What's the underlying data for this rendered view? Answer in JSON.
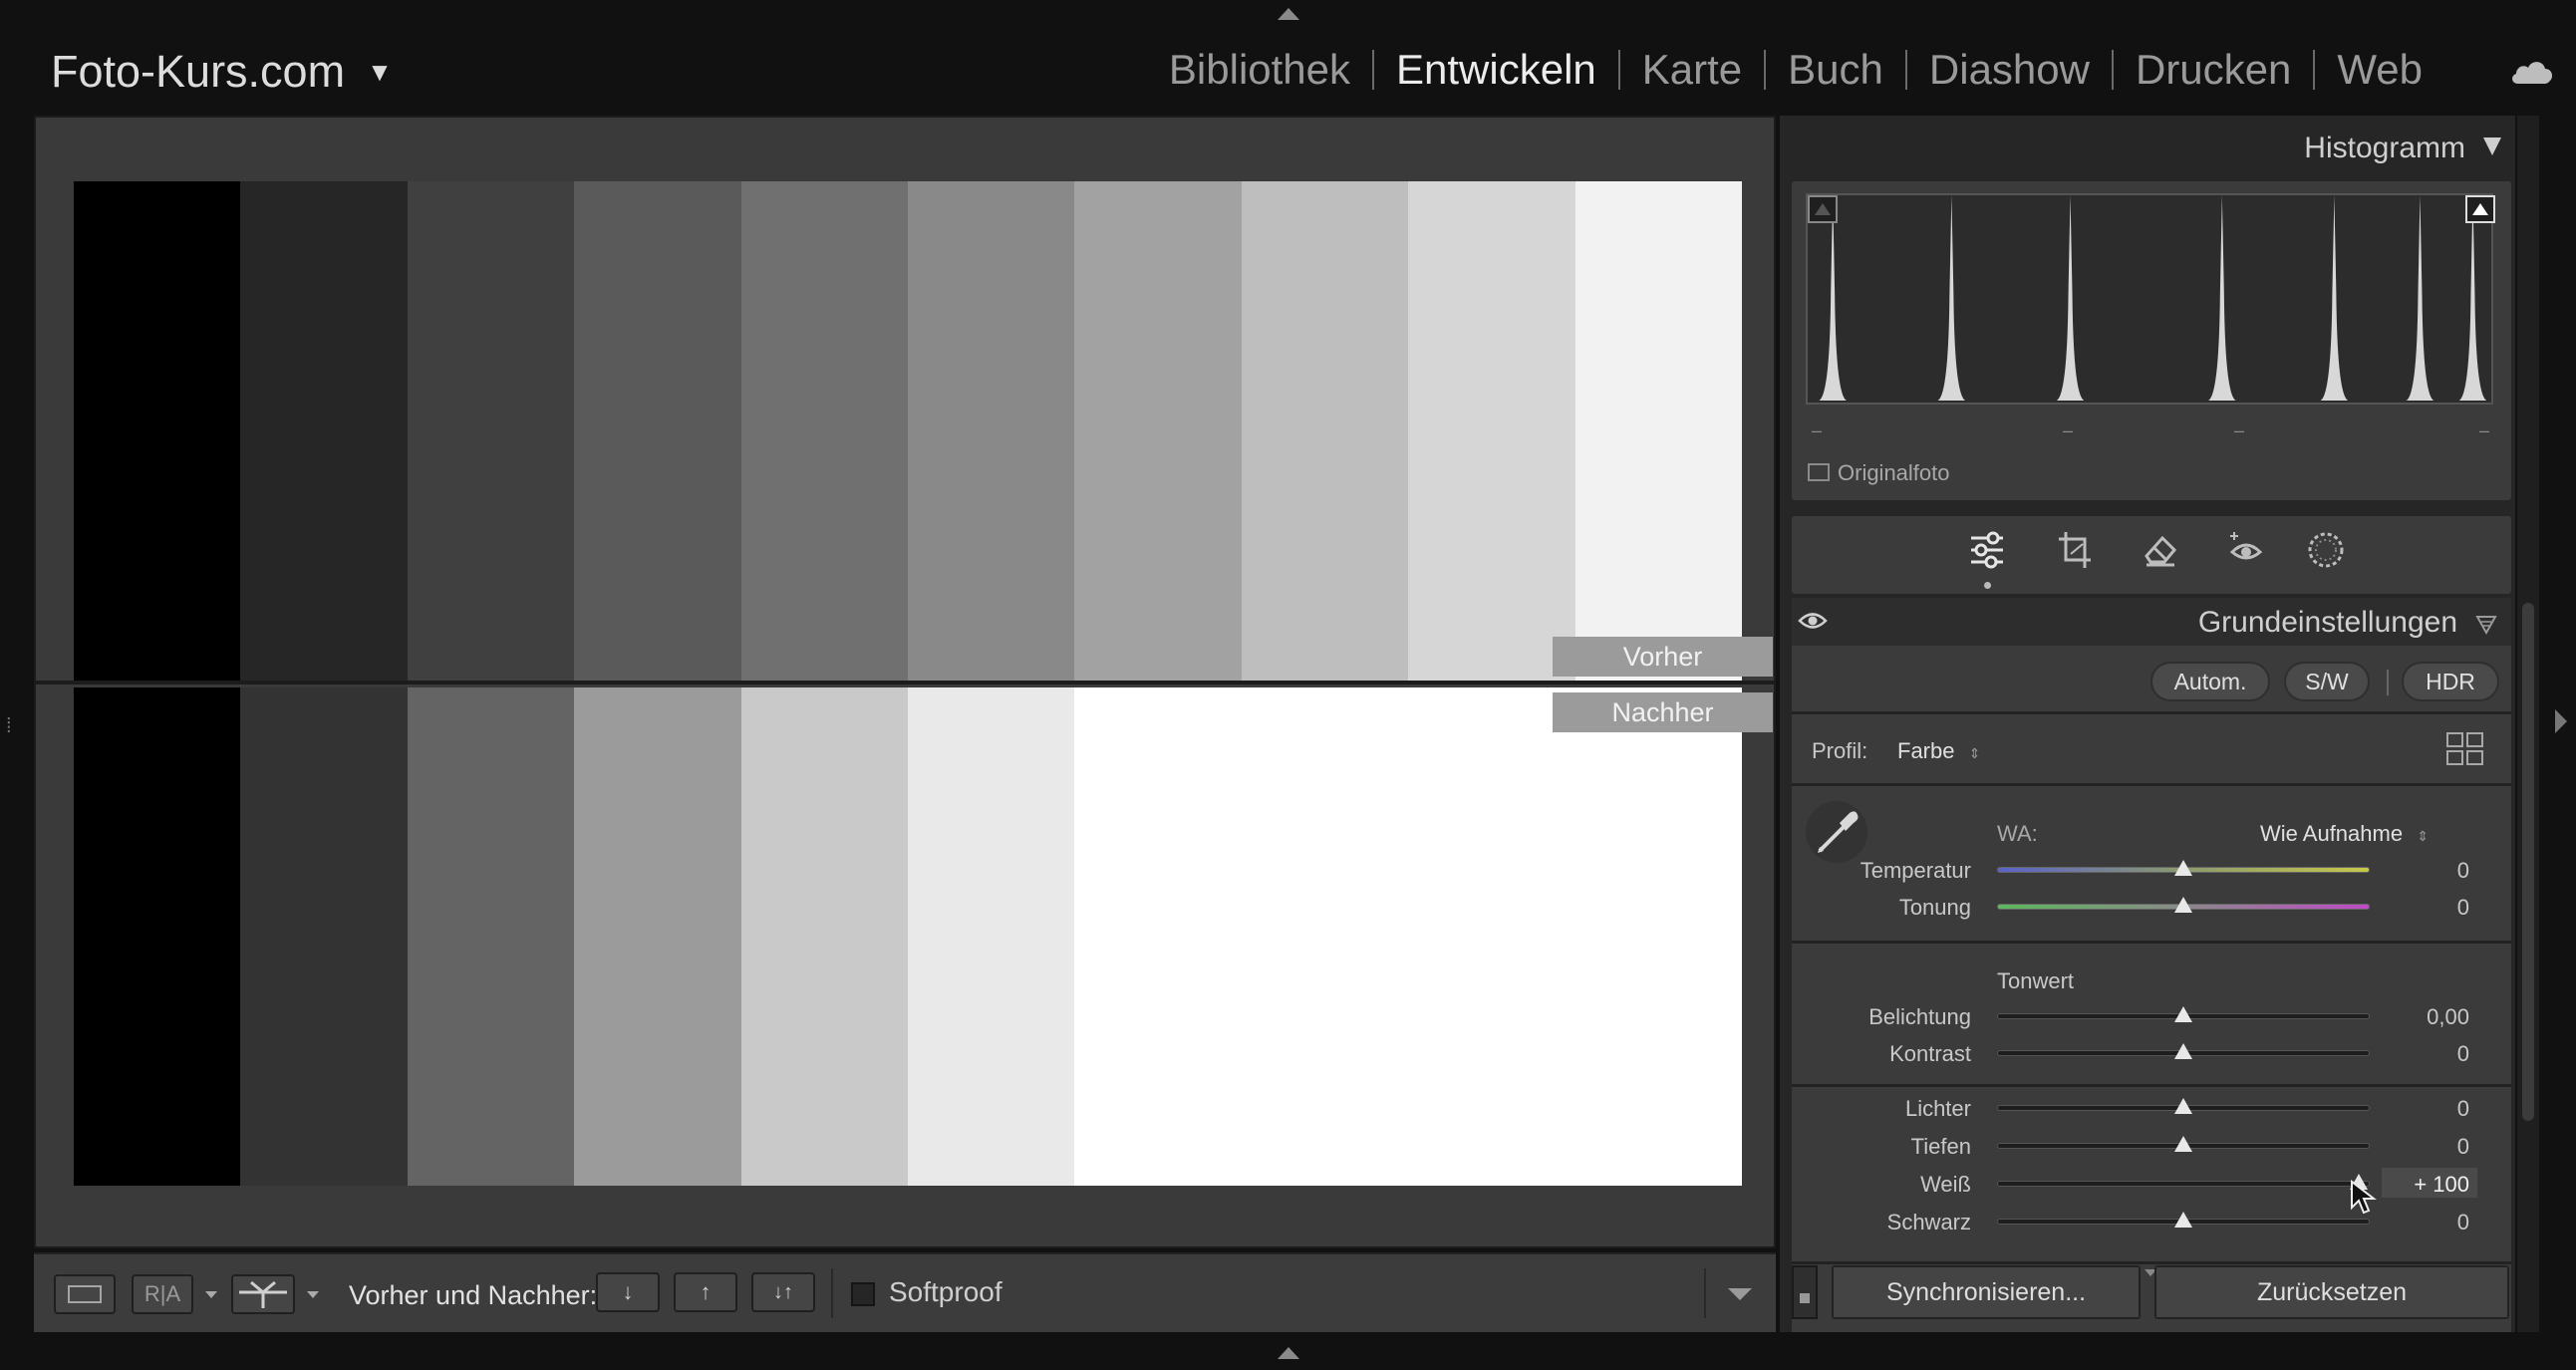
{
  "app": {
    "catalog": "Foto-Kurs.com",
    "modules": [
      "Bibliothek",
      "Entwickeln",
      "Karte",
      "Buch",
      "Diashow",
      "Drucken",
      "Web"
    ],
    "active_module": "Entwickeln",
    "icons": {
      "cloud": "cloud-icon",
      "catalog_menu": "chevron-down-icon"
    }
  },
  "image": {
    "before_swatches": [
      "#000000",
      "#262626",
      "#404040",
      "#5a5a5a",
      "#707070",
      "#898989",
      "#a2a2a2",
      "#bebebe",
      "#d6d6d6",
      "#f2f2f2"
    ],
    "after_swatches": [
      "#000000",
      "#333333",
      "#646464",
      "#9b9b9b",
      "#c9c9c9",
      "#e9e9e9",
      "#ffffff",
      "#ffffff",
      "#ffffff",
      "#ffffff"
    ],
    "before_label": "Vorher",
    "after_label": "Nachher"
  },
  "toolbar": {
    "before_after_label": "Vorher und Nachher:",
    "softproof_label": "Softproof",
    "softproof_checked": false,
    "ra_label": "R|A"
  },
  "histogram": {
    "title": "Histogramm",
    "original_label": "Originalfoto",
    "original_checked": false,
    "readout": [
      "–",
      "–",
      "–",
      "–"
    ],
    "peaks": [
      0.02,
      0.2,
      0.38,
      0.61,
      0.78,
      0.91,
      0.99
    ]
  },
  "basic": {
    "title": "Grundeinstellungen",
    "auto_label": "Autom.",
    "bw_label": "S/W",
    "hdr_label": "HDR",
    "profile_label": "Profil:",
    "profile_value": "Farbe",
    "wb_label": "WA:",
    "wb_value": "Wie Aufnahme",
    "tone_heading": "Tonwert",
    "sliders": [
      {
        "label": "Temperatur",
        "value": "0",
        "fraction": 0.5
      },
      {
        "label": "Tonung",
        "value": "0",
        "fraction": 0.5
      },
      {
        "label": "Belichtung",
        "value": "0,00",
        "fraction": 0.5
      },
      {
        "label": "Kontrast",
        "value": "0",
        "fraction": 0.5
      },
      {
        "label": "Lichter",
        "value": "0",
        "fraction": 0.5
      },
      {
        "label": "Tiefen",
        "value": "0",
        "fraction": 0.5
      },
      {
        "label": "Weiß",
        "value": "+ 100",
        "fraction": 0.97
      },
      {
        "label": "Schwarz",
        "value": "0",
        "fraction": 0.5
      }
    ]
  },
  "bottom": {
    "sync_label": "Synchronisieren...",
    "reset_label": "Zurücksetzen"
  }
}
